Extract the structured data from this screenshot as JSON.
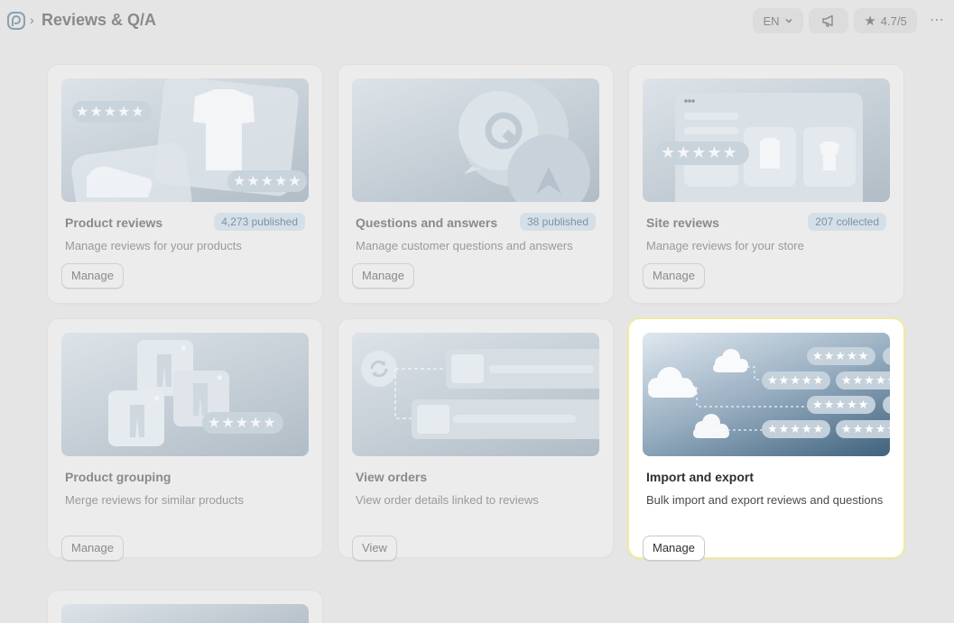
{
  "header": {
    "breadcrumb_sep": "›",
    "title": "Reviews & Q/A",
    "language": "EN",
    "rating": "4.7/5",
    "more": "⋯"
  },
  "stars": "★★★★★",
  "cards": [
    {
      "title": "Product reviews",
      "badge": "4,273 published",
      "description": "Manage reviews for your products",
      "button": "Manage"
    },
    {
      "title": "Questions and answers",
      "badge": "38 published",
      "description": "Manage customer questions and answers",
      "button": "Manage"
    },
    {
      "title": "Site reviews",
      "badge": "207 collected",
      "description": "Manage reviews for your store",
      "button": "Manage"
    },
    {
      "title": "Product grouping",
      "description": "Merge reviews for similar products",
      "button": "Manage"
    },
    {
      "title": "View orders",
      "description": "View order details linked to reviews",
      "button": "View"
    },
    {
      "title": "Import and export",
      "description": "Bulk import and export reviews and questions",
      "button": "Manage"
    }
  ],
  "colors": {
    "background": "#e5e5e5",
    "active_border": "#f3e9a0",
    "badge_bg": "#d5dfe8"
  }
}
